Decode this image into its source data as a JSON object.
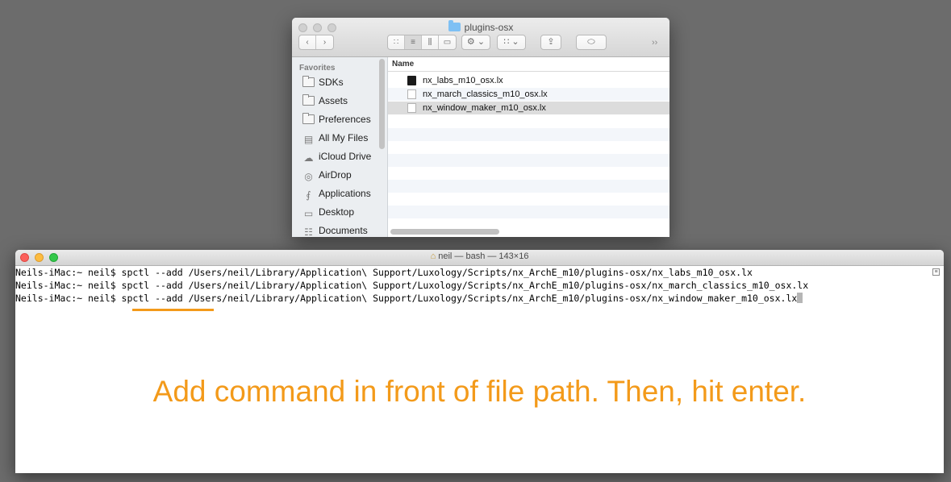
{
  "colors": {
    "accent": "#f39a1a",
    "folder": "#7ec0f4"
  },
  "finder": {
    "title": "plugins-osx",
    "toolbar": {
      "back_icon": "chevron-left-icon",
      "forward_icon": "chevron-right-icon",
      "more": "››"
    },
    "sidebar": {
      "heading": "Favorites",
      "items": [
        {
          "label": "SDKs",
          "icon": "folder-icon"
        },
        {
          "label": "Assets",
          "icon": "folder-icon"
        },
        {
          "label": "Preferences",
          "icon": "folder-icon"
        },
        {
          "label": "All My Files",
          "icon": "all-files-icon"
        },
        {
          "label": "iCloud Drive",
          "icon": "cloud-icon"
        },
        {
          "label": "AirDrop",
          "icon": "airdrop-icon"
        },
        {
          "label": "Applications",
          "icon": "applications-icon"
        },
        {
          "label": "Desktop",
          "icon": "desktop-icon"
        },
        {
          "label": "Documents",
          "icon": "documents-icon"
        }
      ]
    },
    "list": {
      "column_name": "Name",
      "files": [
        {
          "name": "nx_labs_m10_osx.lx",
          "icon": "executable-icon"
        },
        {
          "name": "nx_march_classics_m10_osx.lx",
          "icon": "document-icon"
        },
        {
          "name": "nx_window_maker_m10_osx.lx",
          "icon": "document-icon",
          "selected": true
        }
      ]
    }
  },
  "terminal": {
    "title": "neil — bash — 143×16",
    "lines": [
      "Neils-iMac:~ neil$ spctl --add /Users/neil/Library/Application\\ Support/Luxology/Scripts/nx_ArchE_m10/plugins-osx/nx_labs_m10_osx.lx",
      "Neils-iMac:~ neil$ spctl --add /Users/neil/Library/Application\\ Support/Luxology/Scripts/nx_ArchE_m10/plugins-osx/nx_march_classics_m10_osx.lx",
      "Neils-iMac:~ neil$ spctl --add /Users/neil/Library/Application\\ Support/Luxology/Scripts/nx_ArchE_m10/plugins-osx/nx_window_maker_m10_osx.lx"
    ],
    "annotation": "Add command in front of file path. Then, hit enter."
  }
}
